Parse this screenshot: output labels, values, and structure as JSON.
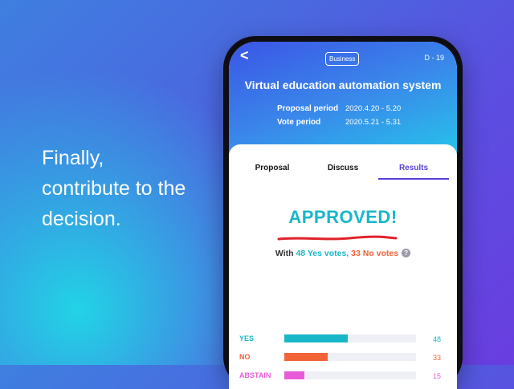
{
  "tagline": [
    "Finally,",
    "contribute to the",
    "decision."
  ],
  "header": {
    "back_icon": "chevron-left-icon",
    "category": "Business",
    "dday": "D - 19",
    "title": "Virtual education automation system",
    "proposal_label": "Proposal period",
    "proposal_value": "2020.4.20 - 5.20",
    "vote_label": "Vote period",
    "vote_value": "2020.5.21 - 5.31"
  },
  "tabs": [
    "Proposal",
    "Discuss",
    "Results"
  ],
  "active_tab": "Results",
  "result": {
    "status": "APPROVED!",
    "summary_prefix": "With ",
    "yes_text": "48 Yes votes,",
    "no_text": "33 No votes",
    "help_icon": "question-circle-icon"
  },
  "votes": {
    "max": 100,
    "rows": [
      {
        "label": "YES",
        "count": 48,
        "color": "#17b7c9"
      },
      {
        "label": "NO",
        "count": 33,
        "color": "#f26337"
      },
      {
        "label": "ABSTAIN",
        "count": 15,
        "color": "#e85ad8"
      }
    ]
  },
  "colors": {
    "accent_purple": "#5b3fd6",
    "approved_teal": "#17b7c9",
    "underline_red": "#e0222a"
  }
}
